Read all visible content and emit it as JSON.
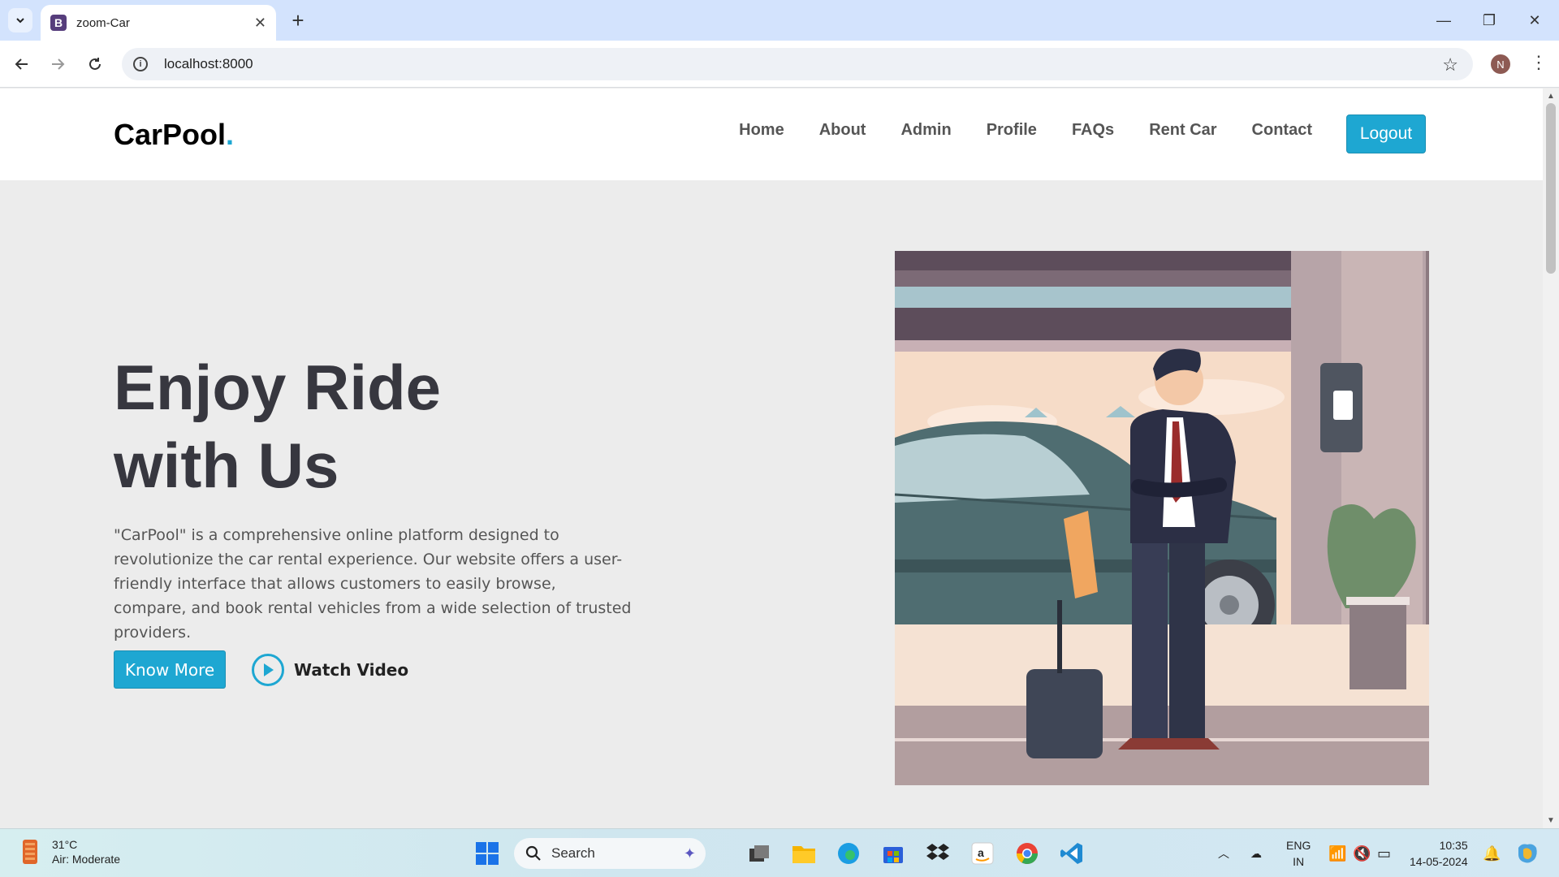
{
  "browser": {
    "tab_title": "zoom-Car",
    "favicon_letter": "B",
    "url": "localhost:8000",
    "profile_initial": "N"
  },
  "site": {
    "logo_text": "CarPool",
    "logo_dot": ".",
    "nav": [
      "Home",
      "About",
      "Admin",
      "Profile",
      "FAQs",
      "Rent Car",
      "Contact"
    ],
    "logout_label": "Logout",
    "accent_color": "#1ea7d2"
  },
  "hero": {
    "title_line1": "Enjoy Ride",
    "title_line2": "with Us",
    "description": "\"CarPool\" is a comprehensive online platform designed to revolutionize the car rental experience. Our website offers a user-friendly interface that allows customers to easily browse, compare, and book rental vehicles from a wide selection of trusted providers.",
    "know_more_label": "Know More",
    "watch_video_label": "Watch Video",
    "illustration": "man-with-car-illustration"
  },
  "taskbar": {
    "weather_temp": "31°C",
    "weather_desc": "Air: Moderate",
    "search_label": "Search",
    "lang_line1": "ENG",
    "lang_line2": "IN",
    "time": "10:35",
    "date": "14-05-2024"
  }
}
